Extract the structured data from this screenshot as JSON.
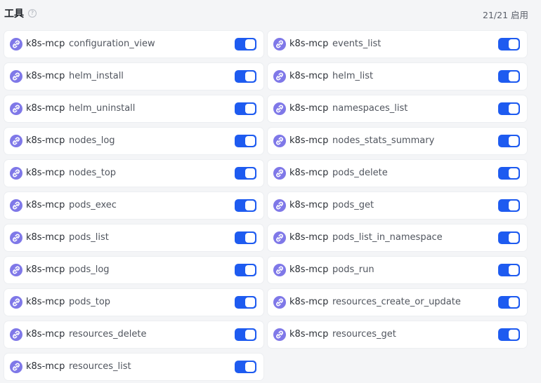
{
  "section": {
    "title": "工具",
    "help_icon": "question-circle-icon",
    "enabled_count": "21/21 启用"
  },
  "colors": {
    "toggle_on": "#1e5bf0",
    "icon_bg": "#7f78e8",
    "page_bg": "#f4f5f7"
  },
  "tools": [
    {
      "server": "k8s-mcp",
      "name": "configuration_view",
      "enabled": true,
      "icon": "link-icon"
    },
    {
      "server": "k8s-mcp",
      "name": "events_list",
      "enabled": true,
      "icon": "link-icon"
    },
    {
      "server": "k8s-mcp",
      "name": "helm_install",
      "enabled": true,
      "icon": "link-icon"
    },
    {
      "server": "k8s-mcp",
      "name": "helm_list",
      "enabled": true,
      "icon": "link-icon"
    },
    {
      "server": "k8s-mcp",
      "name": "helm_uninstall",
      "enabled": true,
      "icon": "link-icon"
    },
    {
      "server": "k8s-mcp",
      "name": "namespaces_list",
      "enabled": true,
      "icon": "link-icon"
    },
    {
      "server": "k8s-mcp",
      "name": "nodes_log",
      "enabled": true,
      "icon": "link-icon"
    },
    {
      "server": "k8s-mcp",
      "name": "nodes_stats_summary",
      "enabled": true,
      "icon": "link-icon"
    },
    {
      "server": "k8s-mcp",
      "name": "nodes_top",
      "enabled": true,
      "icon": "link-icon"
    },
    {
      "server": "k8s-mcp",
      "name": "pods_delete",
      "enabled": true,
      "icon": "link-icon"
    },
    {
      "server": "k8s-mcp",
      "name": "pods_exec",
      "enabled": true,
      "icon": "link-icon"
    },
    {
      "server": "k8s-mcp",
      "name": "pods_get",
      "enabled": true,
      "icon": "link-icon"
    },
    {
      "server": "k8s-mcp",
      "name": "pods_list",
      "enabled": true,
      "icon": "link-icon"
    },
    {
      "server": "k8s-mcp",
      "name": "pods_list_in_namespace",
      "enabled": true,
      "icon": "link-icon"
    },
    {
      "server": "k8s-mcp",
      "name": "pods_log",
      "enabled": true,
      "icon": "link-icon"
    },
    {
      "server": "k8s-mcp",
      "name": "pods_run",
      "enabled": true,
      "icon": "link-icon"
    },
    {
      "server": "k8s-mcp",
      "name": "pods_top",
      "enabled": true,
      "icon": "link-icon"
    },
    {
      "server": "k8s-mcp",
      "name": "resources_create_or_update",
      "enabled": true,
      "icon": "link-icon"
    },
    {
      "server": "k8s-mcp",
      "name": "resources_delete",
      "enabled": true,
      "icon": "link-icon"
    },
    {
      "server": "k8s-mcp",
      "name": "resources_get",
      "enabled": true,
      "icon": "link-icon"
    },
    {
      "server": "k8s-mcp",
      "name": "resources_list",
      "enabled": true,
      "icon": "link-icon"
    }
  ]
}
